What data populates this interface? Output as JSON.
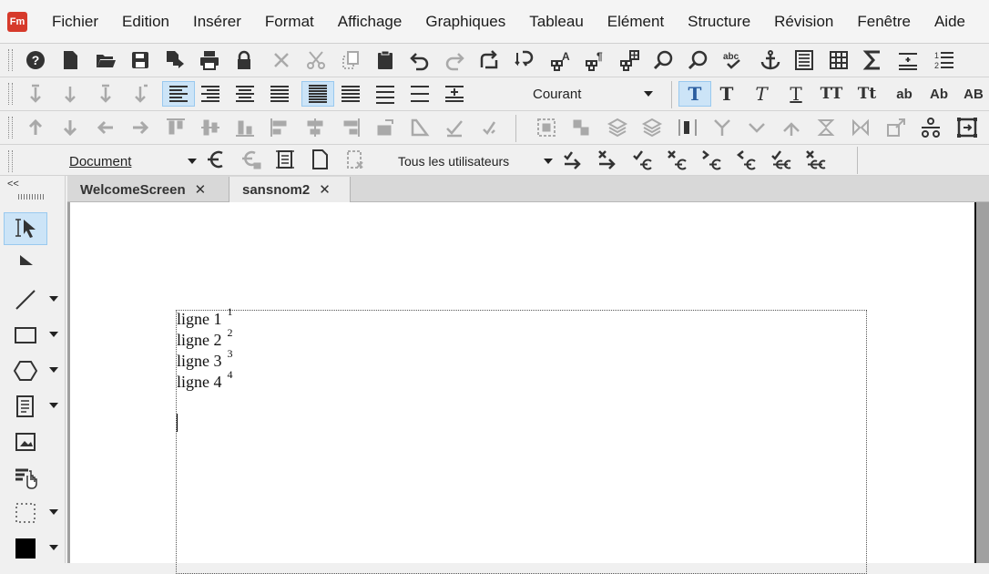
{
  "app": {
    "logo_text": "Fm",
    "accent": "#d63a2b"
  },
  "menu": [
    "Fichier",
    "Edition",
    "Insérer",
    "Format",
    "Affichage",
    "Graphiques",
    "Tableau",
    "Elément",
    "Structure",
    "Révision",
    "Fenêtre",
    "Aide"
  ],
  "format_toolbar": {
    "paragraph_style": "Courant"
  },
  "track_toolbar": {
    "scope": "Document",
    "users": "Tous les utilisateurs"
  },
  "left_panel": {
    "collapse": "<<"
  },
  "tabs": [
    {
      "label": "WelcomeScreen",
      "close": "✕"
    },
    {
      "label": "sansnom2",
      "close": "✕"
    }
  ],
  "document": {
    "lines": [
      {
        "text": "ligne 1",
        "note": "1"
      },
      {
        "text": "ligne 2",
        "note": "2"
      },
      {
        "text": "ligne 3",
        "note": "3"
      },
      {
        "text": "ligne 4",
        "note": "4"
      }
    ]
  },
  "icons": {
    "row1": [
      "help-icon",
      "new-doc-icon",
      "open-icon",
      "save-icon",
      "save-as-icon",
      "print-icon",
      "lock-icon",
      "delete-icon",
      "cut-icon",
      "copy-icon",
      "paste-icon",
      "undo-icon",
      "redo-icon",
      "repeat-icon",
      "update-refs-icon",
      "character-catalog-icon",
      "paragraph-catalog-icon",
      "table-catalog-icon",
      "find-icon",
      "zoom-icon",
      "spelling-icon",
      "anchor-icon",
      "text-frame-icon",
      "table-icon",
      "equation-icon",
      "insert-list-icon",
      "numbered-list-icon"
    ],
    "text_styles": [
      "T",
      "T",
      "T",
      "T",
      "TT",
      "Tt",
      "ab",
      "Ab",
      "AB"
    ]
  }
}
